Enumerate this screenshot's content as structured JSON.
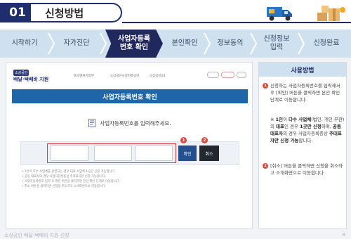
{
  "header": {
    "step_number": "01",
    "title": "신청방법"
  },
  "stepnav": {
    "steps": [
      {
        "label": "시작하기"
      },
      {
        "label": "자가진단"
      },
      {
        "label": "사업자등록\n번호 확인"
      },
      {
        "label": "본인확인"
      },
      {
        "label": "정보동의"
      },
      {
        "label": "신청정보\n입력"
      },
      {
        "label": "신청완료"
      }
    ],
    "active_index": 2
  },
  "main": {
    "logo_badge": "소상공인",
    "logo_text": "배달·택배비 지원",
    "orgs": [
      "중소벤처기업부",
      "소상공인시장진흥공단",
      "소상공인24"
    ],
    "top_links": [
      "",
      "",
      ""
    ],
    "section_title": "사업자등록번호 확인",
    "instruction": "사업자등록번호를 입력해주세요.",
    "confirm_label": "확인",
    "cancel_label": "취소",
    "num1": "1",
    "num2": "2",
    "notes": [
      "• 1인이 다수 사업체를 운영하는 경우 대표 사업체 1곳만 신청 가능합니다.",
      "• 공동 대표자의 경우 사업자등록증상 주대표자만 신청 가능합니다.",
      "• 사업자등록번호 입력 후 확인 버튼을 클릭하면 본인 확인 단계로 이동합니다.",
      "• 취소 버튼을 클릭하면 신청을 취소하고 소개화면으로 이동합니다."
    ]
  },
  "side": {
    "title": "사용방법",
    "item1_num": "1",
    "item1_text_a": "신청하는 사업자등록번호를 입력해서 후 [확인] 버튼을 클릭하면 본인 확인 단계로 이동합니다.",
    "item1_text_b_pre": "※ ",
    "item1_b1": "1인",
    "item1_b1_after": "이 ",
    "item1_b2": "다수 사업체",
    "item1_b2_after": "(법인, 개인 무관)의 ",
    "item1_b3": "대표",
    "item1_b3_after": "인 경우 ",
    "item1_b4": "1곳만 신청",
    "item1_b4_after": "하며, ",
    "item1_b5": "공동 대표자",
    "item1_b5_after": "의 경우 사업자등록증상 ",
    "item1_b6": "주대표자만 신청 가능",
    "item1_b6_after": "합니다.",
    "item2_num": "2",
    "item2_text": "[취소] 버튼을 클릭하면 신청을 취소하고 소개화면으로 이동합니다."
  },
  "footer": {
    "text": "소상공인 배달·택배비 지원 신청",
    "page": "8"
  },
  "colors": {
    "navy": "#1d2d6e",
    "step_active": "#21285e",
    "step_bg": "#cfe0ee",
    "blue_bar": "#1e66a8",
    "red": "#e23b3b"
  }
}
